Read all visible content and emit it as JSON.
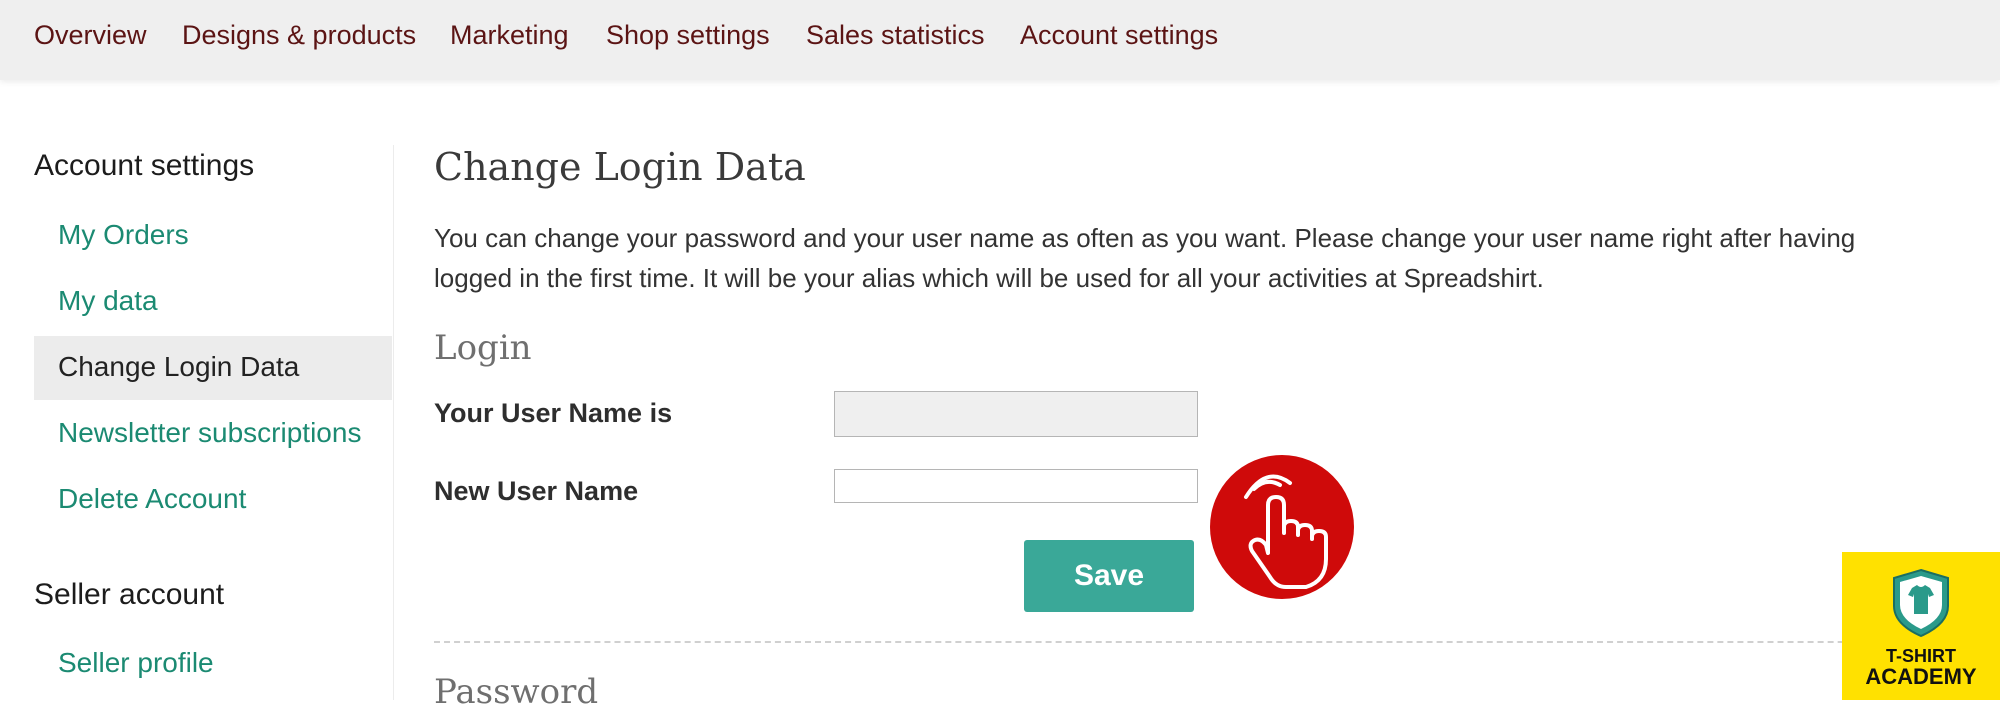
{
  "topnav": {
    "items": [
      {
        "label": "Overview"
      },
      {
        "label": "Designs & products"
      },
      {
        "label": "Marketing"
      },
      {
        "label": "Shop settings"
      },
      {
        "label": "Sales statistics"
      },
      {
        "label": "Account settings"
      }
    ]
  },
  "sidebar": {
    "account_heading": "Account settings",
    "account_items": [
      {
        "label": "My Orders"
      },
      {
        "label": "My data"
      },
      {
        "label": "Change Login Data",
        "active": true
      },
      {
        "label": "Newsletter subscriptions"
      },
      {
        "label": "Delete Account"
      }
    ],
    "seller_heading": "Seller account",
    "seller_items": [
      {
        "label": "Seller profile"
      }
    ]
  },
  "main": {
    "title": "Change Login Data",
    "intro_line1": "You can change your password and your user name as often as you want. Please change your user name right after having",
    "intro_line2": "logged in the first time. It will be your alias which will be used for all your activities at Spreadshirt.",
    "login_section": {
      "title": "Login",
      "username_label": "Your User Name is",
      "username_value": "",
      "new_username_label": "New User Name",
      "new_username_value": "",
      "save_label": "Save"
    },
    "password_section": {
      "title": "Password"
    }
  },
  "overlay": {
    "tap_icon": "hand-pointer-icon",
    "tap_color": "#cf0a0a"
  },
  "badge": {
    "line1": "T-SHIRT",
    "line2": "ACADEMY",
    "icon": "tshirt-shield-icon",
    "color": "#ffe100"
  },
  "colors": {
    "nav_text": "#5b1414",
    "link": "#1b8a72",
    "button": "#3aa898"
  }
}
